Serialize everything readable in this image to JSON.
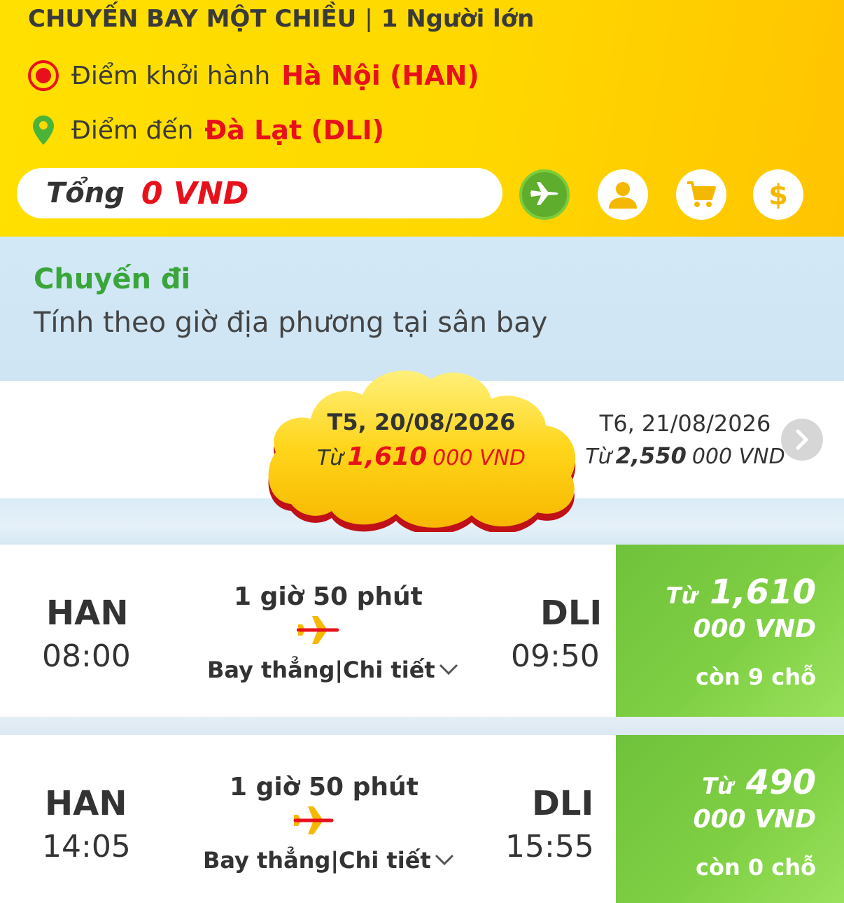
{
  "header": {
    "trip_type": "CHUYẾN BAY MỘT CHIỀU",
    "separator": "|",
    "passengers": "1 Người lớn",
    "departure_label": "Điểm khởi hành",
    "departure_city": "Hà Nội (HAN)",
    "arrival_label": "Điểm đến",
    "arrival_city": "Đà Lạt (DLI)",
    "total_label": "Tổng",
    "total_value": "0 VND",
    "colors": {
      "accent_red": "#e8111b",
      "green": "#5fad2c",
      "yellow": "#ffd800",
      "icon_yellow": "#f5b800"
    }
  },
  "steps": [
    {
      "icon": "plane-icon",
      "active": true
    },
    {
      "icon": "user-icon",
      "active": false
    },
    {
      "icon": "cart-icon",
      "active": false
    },
    {
      "icon": "dollar-icon",
      "active": false
    }
  ],
  "section": {
    "title": "Chuyến đi",
    "subtitle": "Tính theo giờ địa phương tại sân bay"
  },
  "dates": {
    "selected": {
      "date": "T5, 20/08/2026",
      "from": "Từ",
      "price_main": "1,610",
      "price_tail": "000 VND"
    },
    "next": {
      "date": "T6, 21/08/2026",
      "from": "Từ",
      "price_main": "2,550",
      "price_tail": "000 VND"
    }
  },
  "flights": [
    {
      "origin": "HAN",
      "dep_time": "08:00",
      "duration": "1 giờ 50 phút",
      "stops": "Bay thẳng",
      "detail_sep": "|",
      "detail": "Chi tiết",
      "dest": "DLI",
      "arr_time": "09:50",
      "price_from": "Từ",
      "price_main": "1,610",
      "price_tail": "000 VND",
      "seats": "còn 9 chỗ"
    },
    {
      "origin": "HAN",
      "dep_time": "14:05",
      "duration": "1 giờ 50 phút",
      "stops": "Bay thẳng",
      "detail_sep": "|",
      "detail": "Chi tiết",
      "dest": "DLI",
      "arr_time": "15:55",
      "price_from": "Từ",
      "price_main": "490",
      "price_tail": "000 VND",
      "seats": "còn 0 chỗ"
    }
  ]
}
